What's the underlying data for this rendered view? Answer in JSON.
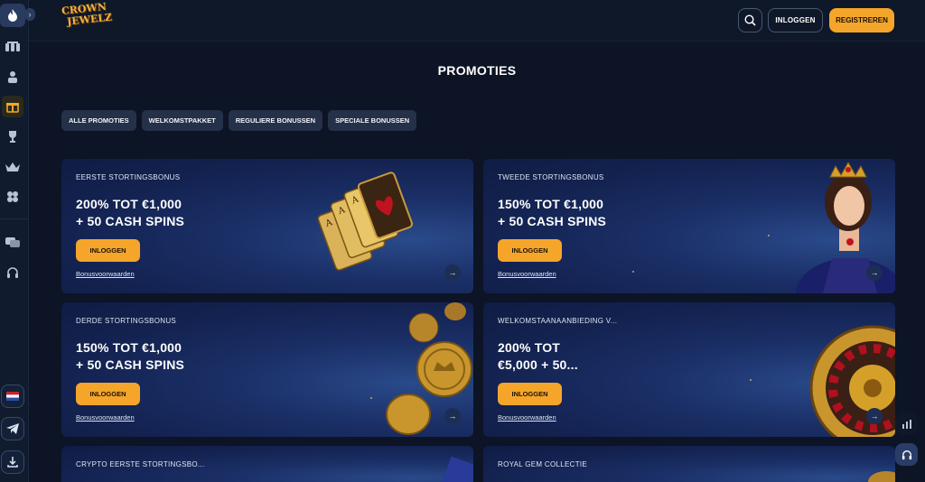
{
  "header": {
    "logo_text_line1": "CROWN",
    "logo_text_line2": "JEWELZ",
    "login_label": "INLOGGEN",
    "register_label": "REGISTREREN"
  },
  "page": {
    "title": "PROMOTIES"
  },
  "tabs": [
    {
      "label": "ALLE PROMOTIES"
    },
    {
      "label": "WELKOMSTPAKKET"
    },
    {
      "label": "REGULIERE BONUSSEN"
    },
    {
      "label": "SPECIALE BONUSSEN"
    }
  ],
  "promotions": [
    {
      "title": "EERSTE STORTINGSBONUS",
      "line1": "200% TOT €1,000",
      "line2": "+ 50 CASH SPINS",
      "button": "INLOGGEN",
      "link": "Bonusvoorwaarden",
      "art": "cards"
    },
    {
      "title": "TWEEDE STORTINGSBONUS",
      "line1": "150% TOT €1,000",
      "line2": "+ 50 CASH SPINS",
      "button": "INLOGGEN",
      "link": "Bonusvoorwaarden",
      "art": "queen"
    },
    {
      "title": "DERDE STORTINGSBONUS",
      "line1": "150% TOT €1,000",
      "line2": "+ 50 CASH SPINS",
      "button": "INLOGGEN",
      "link": "Bonusvoorwaarden",
      "art": "coins"
    },
    {
      "title": "WELKOMSTAANAANBIEDING V...",
      "line1": "200% TOT",
      "line2": "€5,000 + 50...",
      "button": "INLOGGEN",
      "link": "Bonusvoorwaarden",
      "art": "roulette"
    },
    {
      "title": "CRYPTO EERSTE STORTINGSBO...",
      "art": "crypto"
    },
    {
      "title": "ROYAL GEM COLLECTIE",
      "art": "gems"
    }
  ],
  "colors": {
    "accent": "#f5a52a",
    "background": "#0c1425",
    "card": "#132250"
  }
}
